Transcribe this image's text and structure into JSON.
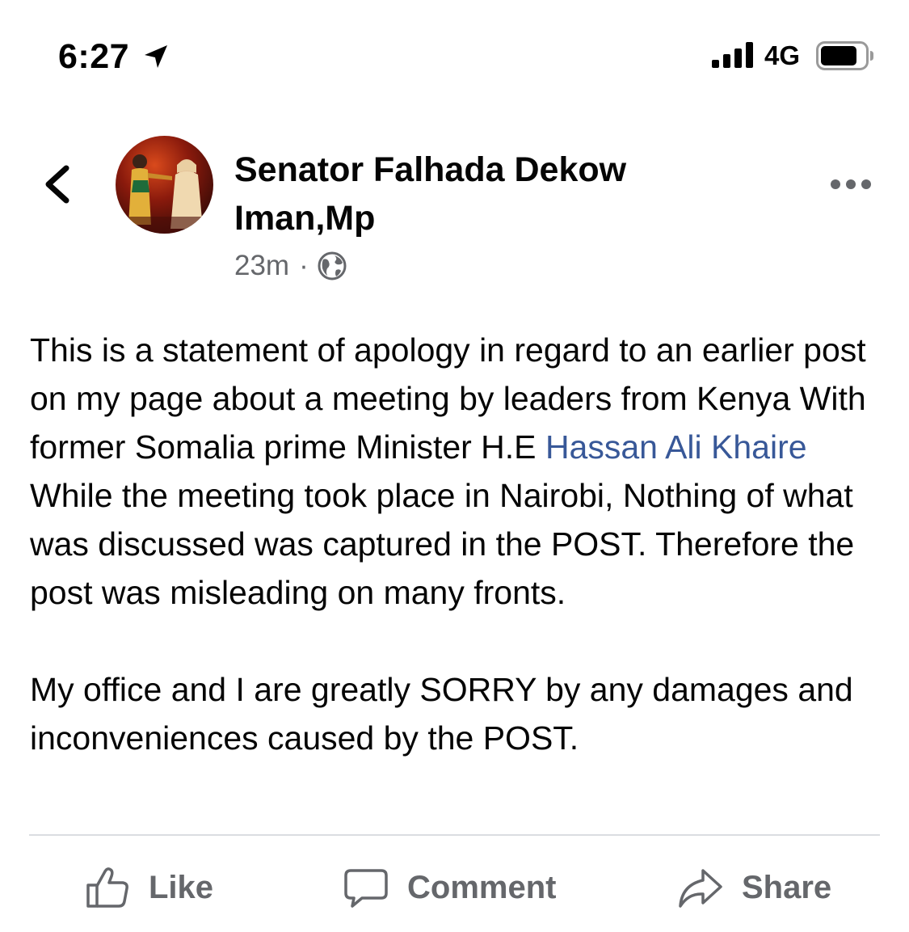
{
  "status_bar": {
    "time": "6:27",
    "network": "4G",
    "icons": [
      "location-arrow-icon",
      "signal-bars-icon",
      "battery-icon"
    ]
  },
  "header": {
    "author_name": "Senator Falhada Dekow Iman,Mp",
    "timestamp": "23m",
    "separator": "·",
    "audience_icon": "globe-icon",
    "back_icon": "chevron-left-icon",
    "more_icon": "more-horizontal-icon"
  },
  "post": {
    "paragraph1_before": "This is a statement of apology in regard to an earlier post on my page about a meeting by leaders from Kenya With former Somalia prime Minister H.E ",
    "mention": "Hassan Ali Khaire",
    "paragraph1_after": " While the meeting took place in Nairobi, Nothing of what was discussed was captured in the POST. Therefore the post was misleading on many fronts.",
    "paragraph2": "My office and I are greatly SORRY by any damages and inconveniences caused by the POST."
  },
  "actions": {
    "like_label": "Like",
    "comment_label": "Comment",
    "share_label": "Share"
  },
  "colors": {
    "text": "#050505",
    "secondary_text": "#65676b",
    "link": "#385898",
    "divider": "#dadde1"
  }
}
